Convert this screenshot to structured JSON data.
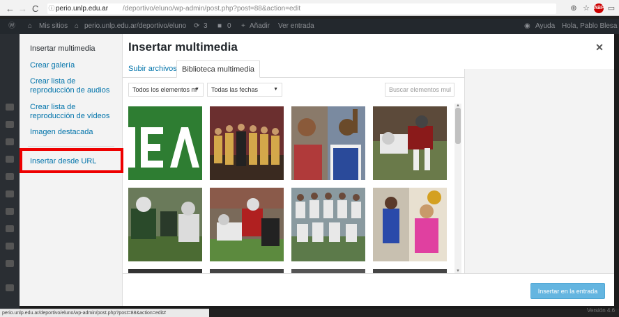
{
  "browser": {
    "url_host": "perio.unlp.edu.ar",
    "url_path": "/deportivo/eluno/wp-admin/post.php?post=88&action=edit",
    "back_icon": "back-arrow-icon",
    "forward_icon": "forward-arrow-icon",
    "reload_icon": "reload-icon",
    "info_icon": "info-icon",
    "status_url": "perio.unlp.edu.ar/deportivo/eluno/wp-admin/post.php?post=88&action=edit#"
  },
  "admin_bar": {
    "my_sites": "Mis sitios",
    "site_name": "perio.unlp.edu.ar/deportivo/eluno",
    "updates_count": "3",
    "comments_count": "0",
    "add_new": "Añadir",
    "view_post": "Ver entrada",
    "help": "Ayuda",
    "greeting": "Hola, Pablo Blesa"
  },
  "modal": {
    "title": "Insertar multimedia",
    "close_icon": "close-icon",
    "menu": [
      {
        "label": "Insertar multimedia"
      },
      {
        "label": "Crear galería"
      },
      {
        "label": "Crear lista de reproducción de audios"
      },
      {
        "label": "Crear lista de reproducción de vídeos"
      },
      {
        "label": "Imagen destacada"
      },
      {
        "label": "Insertar desde URL"
      }
    ],
    "tabs": [
      {
        "label": "Subir archivos"
      },
      {
        "label": "Biblioteca multimedia"
      }
    ],
    "filter_type": "Todos los elementos m",
    "filter_date": "Todas las fechas",
    "search_placeholder": "Buscar elementos mul",
    "insert_button": "Insertar en la entrada",
    "thumbnails": [
      {
        "name": "jea-logo-thumb",
        "color": "#2e7d32"
      },
      {
        "name": "team-photo-thumb",
        "color": "#8a6d3b"
      },
      {
        "name": "basketball-thumb",
        "color": "#b03a3a"
      },
      {
        "name": "football-tackle-thumb",
        "color": "#7b4a3a"
      },
      {
        "name": "football-line-thumb",
        "color": "#4b6b43"
      },
      {
        "name": "football-run-thumb",
        "color": "#5c7a3e"
      },
      {
        "name": "soccer-team-thumb",
        "color": "#7d8b6a"
      },
      {
        "name": "athletes-thumb",
        "color": "#c89a6a"
      }
    ]
  },
  "footer": {
    "version": "Versión 4.6"
  }
}
